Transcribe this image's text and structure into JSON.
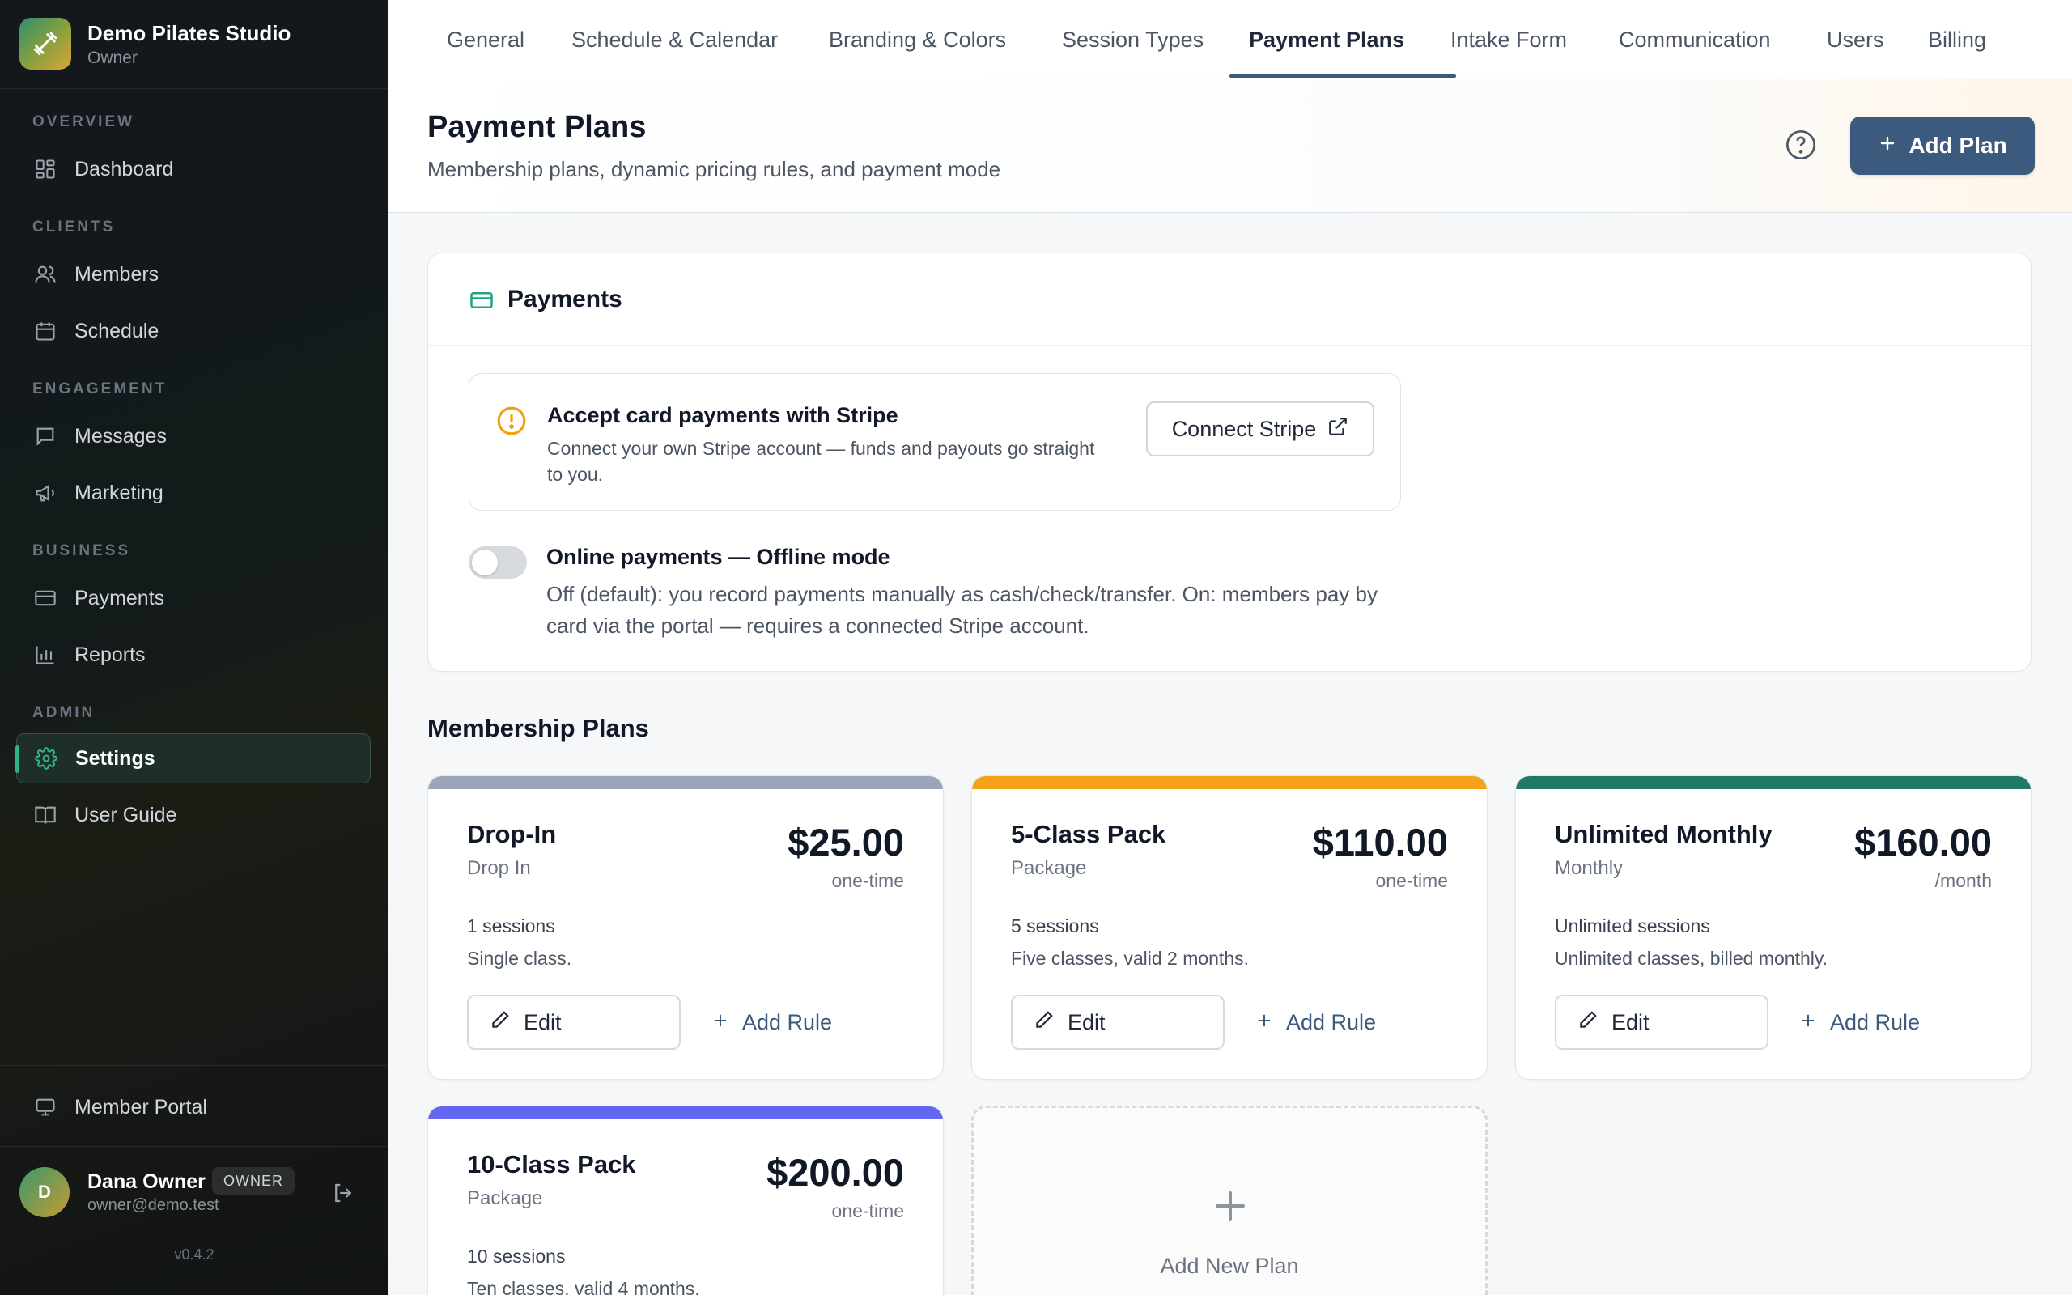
{
  "sidebar": {
    "studio_name": "Demo Pilates Studio",
    "studio_role": "Owner",
    "sections": {
      "overview": "OVERVIEW",
      "clients": "CLIENTS",
      "engagement": "ENGAGEMENT",
      "business": "BUSINESS",
      "admin": "ADMIN"
    },
    "items": {
      "dashboard": "Dashboard",
      "members": "Members",
      "schedule": "Schedule",
      "messages": "Messages",
      "marketing": "Marketing",
      "payments": "Payments",
      "reports": "Reports",
      "settings": "Settings",
      "user_guide": "User Guide",
      "member_portal": "Member Portal"
    },
    "user": {
      "initial": "D",
      "name": "Dana Owner",
      "badge": "OWNER",
      "email": "owner@demo.test"
    },
    "version": "v0.4.2"
  },
  "tabs": [
    "General",
    "Schedule & Calendar",
    "Branding & Colors",
    "Session Types",
    "Payment Plans",
    "Intake Form",
    "Communication",
    "Users",
    "Billing"
  ],
  "active_tab": "Payment Plans",
  "header": {
    "title": "Payment Plans",
    "subtitle": "Membership plans, dynamic pricing rules, and payment mode",
    "add_plan_label": "Add Plan"
  },
  "payments": {
    "title": "Payments",
    "stripe_title": "Accept card payments with Stripe",
    "stripe_desc": "Connect your own Stripe account — funds and payouts go straight to you.",
    "connect_label": "Connect Stripe",
    "online_mode_title": "Online payments — Offline mode",
    "online_mode_desc": "Off (default): you record payments manually as cash/check/transfer. On: members pay by card via the portal — requires a connected Stripe account.",
    "online_enabled": false
  },
  "membership": {
    "title": "Membership Plans",
    "edit_label": "Edit",
    "add_rule_label": "Add Rule",
    "add_new_label": "Add New Plan",
    "plans": [
      {
        "name": "Drop-In",
        "type": "Drop In",
        "price": "$25.00",
        "period": "one-time",
        "sessions": "1 sessions",
        "description": "Single class.",
        "color": "#9aa5b8"
      },
      {
        "name": "5-Class Pack",
        "type": "Package",
        "price": "$110.00",
        "period": "one-time",
        "sessions": "5 sessions",
        "description": "Five classes, valid 2 months.",
        "color": "#f3a21a"
      },
      {
        "name": "Unlimited Monthly",
        "type": "Monthly",
        "price": "$160.00",
        "period": "/month",
        "sessions": "Unlimited sessions",
        "description": "Unlimited classes, billed monthly.",
        "color": "#1e7a66"
      },
      {
        "name": "10-Class Pack",
        "type": "Package",
        "price": "$200.00",
        "period": "one-time",
        "sessions": "10 sessions",
        "description": "Ten classes, valid 4 months.",
        "color": "#6366f1"
      }
    ]
  },
  "colors": {
    "accent": "#3b5a7d",
    "teal": "#2fb38a",
    "warning": "#f59e0b"
  }
}
